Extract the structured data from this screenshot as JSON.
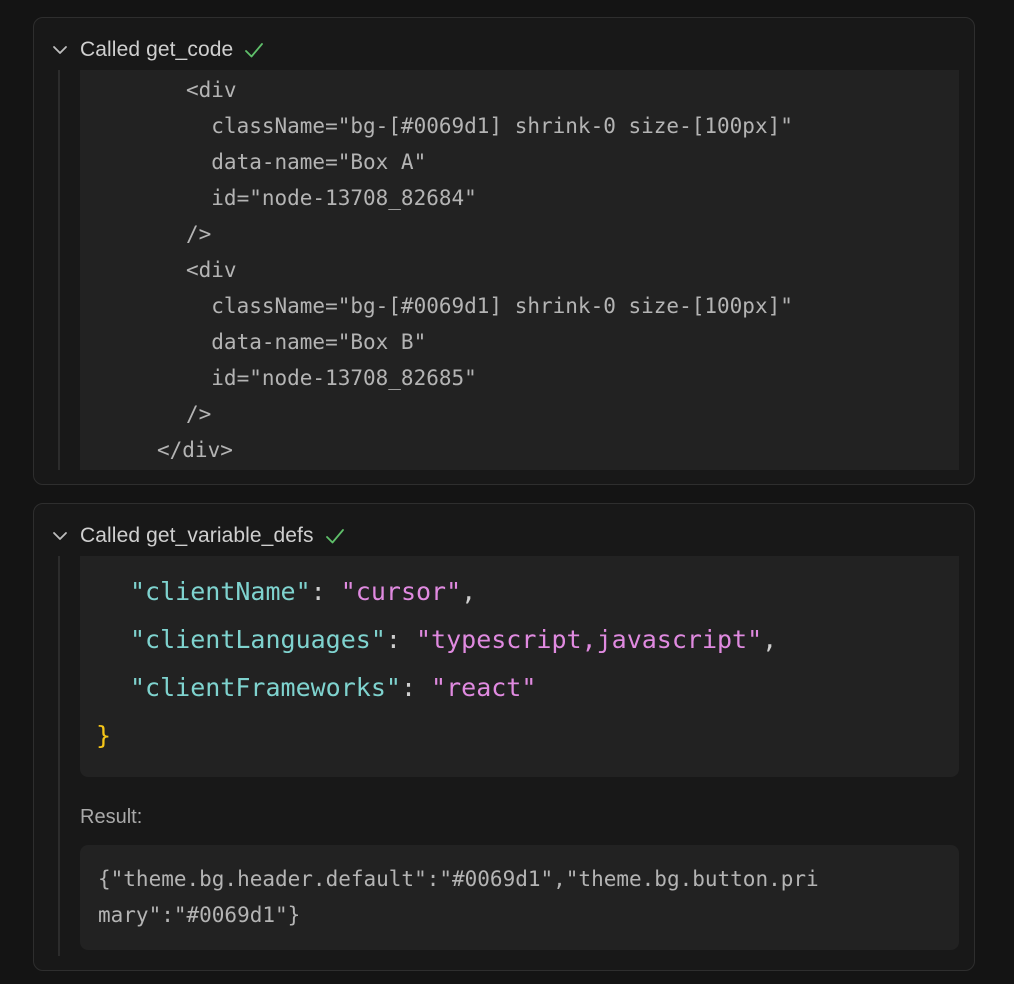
{
  "panels": [
    {
      "title": "Called get_code",
      "expanded": true,
      "status": "success",
      "code_lines": [
        "<div",
        "  className=\"bg-[#0069d1] shrink-0 size-[100px]\"",
        "  data-name=\"Box A\"",
        "  id=\"node-13708_82684\"",
        "/>",
        "<div",
        "  className=\"bg-[#0069d1] shrink-0 size-[100px]\"",
        "  data-name=\"Box B\"",
        "  id=\"node-13708_82685\"",
        "/>",
        "</div>"
      ]
    },
    {
      "title": "Called get_variable_defs",
      "expanded": true,
      "status": "success",
      "json_lines": [
        {
          "key": "\"clientName\"",
          "value": "\"cursor\"",
          "trailing": ","
        },
        {
          "key": "\"clientLanguages\"",
          "value": "\"typescript,javascript\"",
          "trailing": ","
        },
        {
          "key": "\"clientFrameworks\"",
          "value": "\"react\"",
          "trailing": ""
        }
      ],
      "closing_brace": "}",
      "result_label": "Result:",
      "result_lines": [
        "{\"theme.bg.header.default\":\"#0069d1\",\"theme.bg.button.pri",
        "mary\":\"#0069d1\"}"
      ]
    }
  ],
  "colors": {
    "background": "#141414",
    "panel": "#181818",
    "code_bg": "#222222",
    "check": "#5fbf6a",
    "json_key": "#7fd3cf",
    "json_string": "#e08ae0",
    "json_brace": "#f5c518"
  },
  "icons": {
    "chevron": "chevron-down-icon",
    "status": "checkmark-icon"
  }
}
